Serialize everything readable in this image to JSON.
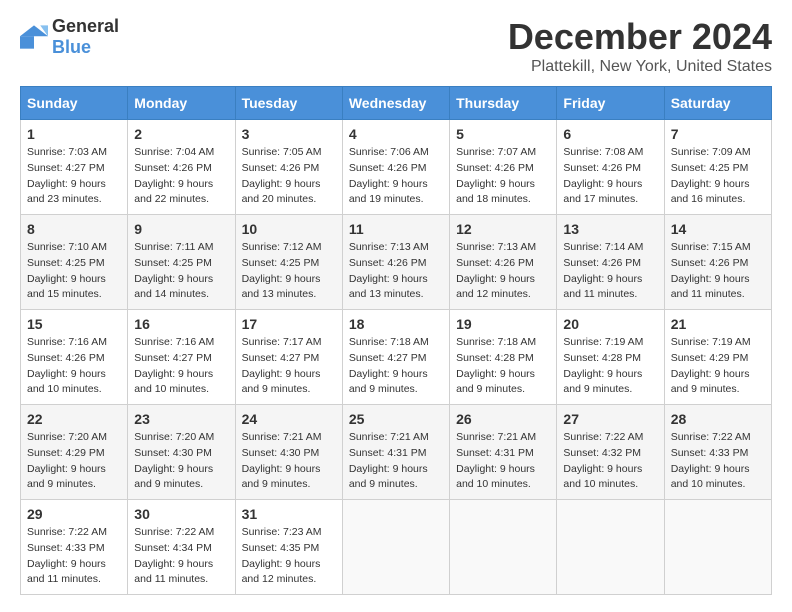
{
  "logo": {
    "general": "General",
    "blue": "Blue"
  },
  "title": "December 2024",
  "subtitle": "Plattekill, New York, United States",
  "days_of_week": [
    "Sunday",
    "Monday",
    "Tuesday",
    "Wednesday",
    "Thursday",
    "Friday",
    "Saturday"
  ],
  "weeks": [
    [
      {
        "day": "1",
        "sunrise": "7:03 AM",
        "sunset": "4:27 PM",
        "daylight": "9 hours and 23 minutes."
      },
      {
        "day": "2",
        "sunrise": "7:04 AM",
        "sunset": "4:26 PM",
        "daylight": "9 hours and 22 minutes."
      },
      {
        "day": "3",
        "sunrise": "7:05 AM",
        "sunset": "4:26 PM",
        "daylight": "9 hours and 20 minutes."
      },
      {
        "day": "4",
        "sunrise": "7:06 AM",
        "sunset": "4:26 PM",
        "daylight": "9 hours and 19 minutes."
      },
      {
        "day": "5",
        "sunrise": "7:07 AM",
        "sunset": "4:26 PM",
        "daylight": "9 hours and 18 minutes."
      },
      {
        "day": "6",
        "sunrise": "7:08 AM",
        "sunset": "4:26 PM",
        "daylight": "9 hours and 17 minutes."
      },
      {
        "day": "7",
        "sunrise": "7:09 AM",
        "sunset": "4:25 PM",
        "daylight": "9 hours and 16 minutes."
      }
    ],
    [
      {
        "day": "8",
        "sunrise": "7:10 AM",
        "sunset": "4:25 PM",
        "daylight": "9 hours and 15 minutes."
      },
      {
        "day": "9",
        "sunrise": "7:11 AM",
        "sunset": "4:25 PM",
        "daylight": "9 hours and 14 minutes."
      },
      {
        "day": "10",
        "sunrise": "7:12 AM",
        "sunset": "4:25 PM",
        "daylight": "9 hours and 13 minutes."
      },
      {
        "day": "11",
        "sunrise": "7:13 AM",
        "sunset": "4:26 PM",
        "daylight": "9 hours and 13 minutes."
      },
      {
        "day": "12",
        "sunrise": "7:13 AM",
        "sunset": "4:26 PM",
        "daylight": "9 hours and 12 minutes."
      },
      {
        "day": "13",
        "sunrise": "7:14 AM",
        "sunset": "4:26 PM",
        "daylight": "9 hours and 11 minutes."
      },
      {
        "day": "14",
        "sunrise": "7:15 AM",
        "sunset": "4:26 PM",
        "daylight": "9 hours and 11 minutes."
      }
    ],
    [
      {
        "day": "15",
        "sunrise": "7:16 AM",
        "sunset": "4:26 PM",
        "daylight": "9 hours and 10 minutes."
      },
      {
        "day": "16",
        "sunrise": "7:16 AM",
        "sunset": "4:27 PM",
        "daylight": "9 hours and 10 minutes."
      },
      {
        "day": "17",
        "sunrise": "7:17 AM",
        "sunset": "4:27 PM",
        "daylight": "9 hours and 9 minutes."
      },
      {
        "day": "18",
        "sunrise": "7:18 AM",
        "sunset": "4:27 PM",
        "daylight": "9 hours and 9 minutes."
      },
      {
        "day": "19",
        "sunrise": "7:18 AM",
        "sunset": "4:28 PM",
        "daylight": "9 hours and 9 minutes."
      },
      {
        "day": "20",
        "sunrise": "7:19 AM",
        "sunset": "4:28 PM",
        "daylight": "9 hours and 9 minutes."
      },
      {
        "day": "21",
        "sunrise": "7:19 AM",
        "sunset": "4:29 PM",
        "daylight": "9 hours and 9 minutes."
      }
    ],
    [
      {
        "day": "22",
        "sunrise": "7:20 AM",
        "sunset": "4:29 PM",
        "daylight": "9 hours and 9 minutes."
      },
      {
        "day": "23",
        "sunrise": "7:20 AM",
        "sunset": "4:30 PM",
        "daylight": "9 hours and 9 minutes."
      },
      {
        "day": "24",
        "sunrise": "7:21 AM",
        "sunset": "4:30 PM",
        "daylight": "9 hours and 9 minutes."
      },
      {
        "day": "25",
        "sunrise": "7:21 AM",
        "sunset": "4:31 PM",
        "daylight": "9 hours and 9 minutes."
      },
      {
        "day": "26",
        "sunrise": "7:21 AM",
        "sunset": "4:31 PM",
        "daylight": "9 hours and 10 minutes."
      },
      {
        "day": "27",
        "sunrise": "7:22 AM",
        "sunset": "4:32 PM",
        "daylight": "9 hours and 10 minutes."
      },
      {
        "day": "28",
        "sunrise": "7:22 AM",
        "sunset": "4:33 PM",
        "daylight": "9 hours and 10 minutes."
      }
    ],
    [
      {
        "day": "29",
        "sunrise": "7:22 AM",
        "sunset": "4:33 PM",
        "daylight": "9 hours and 11 minutes."
      },
      {
        "day": "30",
        "sunrise": "7:22 AM",
        "sunset": "4:34 PM",
        "daylight": "9 hours and 11 minutes."
      },
      {
        "day": "31",
        "sunrise": "7:23 AM",
        "sunset": "4:35 PM",
        "daylight": "9 hours and 12 minutes."
      },
      null,
      null,
      null,
      null
    ]
  ],
  "labels": {
    "sunrise": "Sunrise:",
    "sunset": "Sunset:",
    "daylight": "Daylight:"
  }
}
